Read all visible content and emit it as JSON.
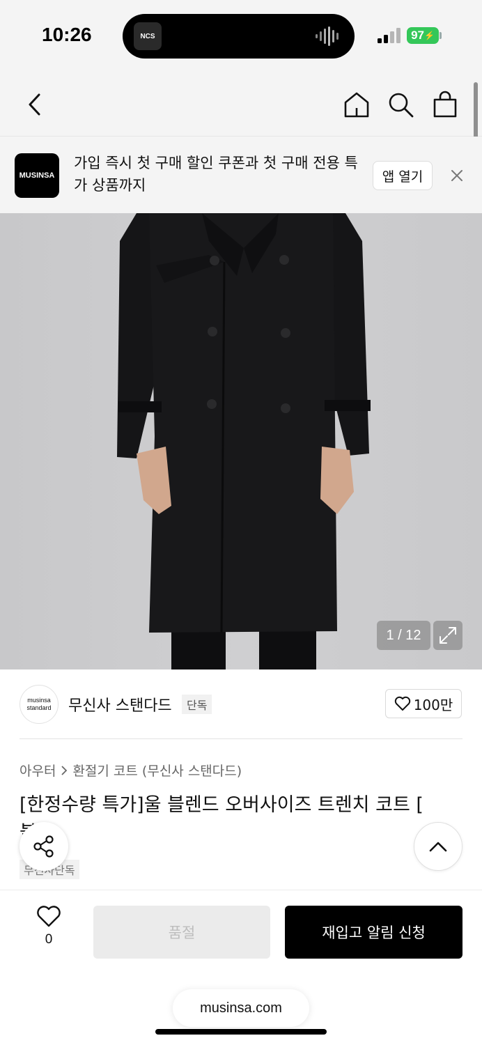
{
  "status_bar": {
    "time": "10:26",
    "island_app_label": "NCS",
    "battery": "97"
  },
  "header": {
    "back_icon": "chevron-left-icon",
    "home_icon": "home-icon",
    "search_icon": "search-icon",
    "cart_icon": "shopping-bag-icon"
  },
  "banner": {
    "logo_text": "MUSINSA",
    "message": "가입 즉시 첫 구매 할인 쿠폰과 첫 구매 전용 특가 상품까지",
    "open_app_label": "앱 열기"
  },
  "gallery": {
    "counter": "1 / 12"
  },
  "brand": {
    "logo_line1": "musinsa",
    "logo_line2": "standard",
    "name": "무신사 스탠다드",
    "badge": "단독",
    "likes": "100만"
  },
  "product": {
    "breadcrumb": [
      "아우터",
      "환절기 코트 (무신사 스탠다드)"
    ],
    "title": "[한정수량 특가]울 블렌드 오버사이즈 트렌치 코트 [",
    "title_partial": "블랙]",
    "tag": "무신사단독"
  },
  "bottom_bar": {
    "wish_count": "0",
    "soldout_label": "품절",
    "restock_label": "재입고 알림 신청"
  },
  "browser": {
    "url": "musinsa.com"
  },
  "colors": {
    "accent": "#000000",
    "battery_green": "#34c759",
    "disabled_bg": "#ebebeb"
  }
}
